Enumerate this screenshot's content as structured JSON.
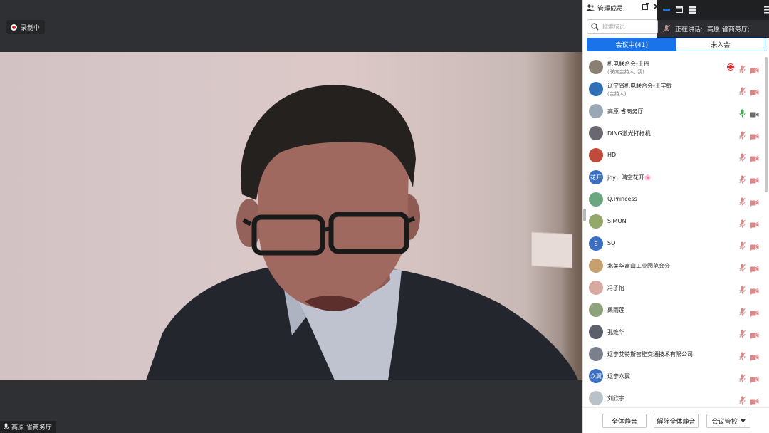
{
  "recording": {
    "label": "录制中"
  },
  "speaker_tag": {
    "label": "高原 省商务厅"
  },
  "panel": {
    "title": "管理成员",
    "search_placeholder": "搜索成员",
    "tabs": [
      {
        "label": "会议中(41)",
        "active": true
      },
      {
        "label": "未入会",
        "active": false
      }
    ]
  },
  "talk_bar": {
    "label": "正在讲话:",
    "speaker": "高原 省商务厅;"
  },
  "participants": [
    {
      "name": "机电联合会-王丹",
      "sub": "(联席主持人, 我)",
      "avatar_text": "",
      "avatar_color": "#8a7f73",
      "mic": "muted",
      "recording": true
    },
    {
      "name": "辽宁省机电联合会-王学敏",
      "sub": "(主持人)",
      "avatar_text": "",
      "avatar_color": "#2f6fb5",
      "mic": "muted",
      "recording": false
    },
    {
      "name": "高原 省商务厅",
      "sub": "",
      "avatar_text": "",
      "avatar_color": "#9aa7b4",
      "mic": "active",
      "recording": false
    },
    {
      "name": "DING激光打标机",
      "sub": "",
      "avatar_text": "",
      "avatar_color": "#6b6770",
      "mic": "muted",
      "recording": false
    },
    {
      "name": "HD",
      "sub": "",
      "avatar_text": "",
      "avatar_color": "#c04a3c",
      "mic": "muted",
      "recording": false
    },
    {
      "name": "joy，晴空花开🌸",
      "sub": "",
      "avatar_text": "花开",
      "avatar_color": "#3b6fc4",
      "mic": "muted",
      "recording": false
    },
    {
      "name": "Q.Princess",
      "sub": "",
      "avatar_text": "",
      "avatar_color": "#6ba882",
      "mic": "muted",
      "recording": false
    },
    {
      "name": "SIMON",
      "sub": "",
      "avatar_text": "",
      "avatar_color": "#93a86a",
      "mic": "muted",
      "recording": false
    },
    {
      "name": "SQ",
      "sub": "",
      "avatar_text": "S",
      "avatar_color": "#3b6fc4",
      "mic": "muted",
      "recording": false
    },
    {
      "name": "北美华富山工业园范会会",
      "sub": "",
      "avatar_text": "",
      "avatar_color": "#c7a06f",
      "mic": "muted",
      "recording": false
    },
    {
      "name": "冯子怡",
      "sub": "",
      "avatar_text": "",
      "avatar_color": "#d8a9a0",
      "mic": "muted",
      "recording": false
    },
    {
      "name": "果雨莲",
      "sub": "",
      "avatar_text": "",
      "avatar_color": "#8ea37a",
      "mic": "muted",
      "recording": false
    },
    {
      "name": "孔维华",
      "sub": "",
      "avatar_text": "",
      "avatar_color": "#5a5f6b",
      "mic": "muted",
      "recording": false
    },
    {
      "name": "辽宁艾特斯智能交通技术有限公司",
      "sub": "",
      "avatar_text": "",
      "avatar_color": "#7a7f8c",
      "mic": "muted",
      "recording": false
    },
    {
      "name": "辽宁众翼",
      "sub": "",
      "avatar_text": "众翼",
      "avatar_color": "#3b6fc4",
      "mic": "muted",
      "recording": false
    },
    {
      "name": "刘欣宇",
      "sub": "",
      "avatar_text": "",
      "avatar_color": "#b9c2c9",
      "mic": "muted",
      "recording": false
    }
  ],
  "footer": {
    "mute_all": "全体静音",
    "unmute_all": "解除全体静音",
    "controls": "会议管控"
  },
  "colors": {
    "accent": "#1a73e8",
    "muted_mic": "#d88a8a",
    "active_mic": "#35b24a",
    "record": "#e02424"
  }
}
